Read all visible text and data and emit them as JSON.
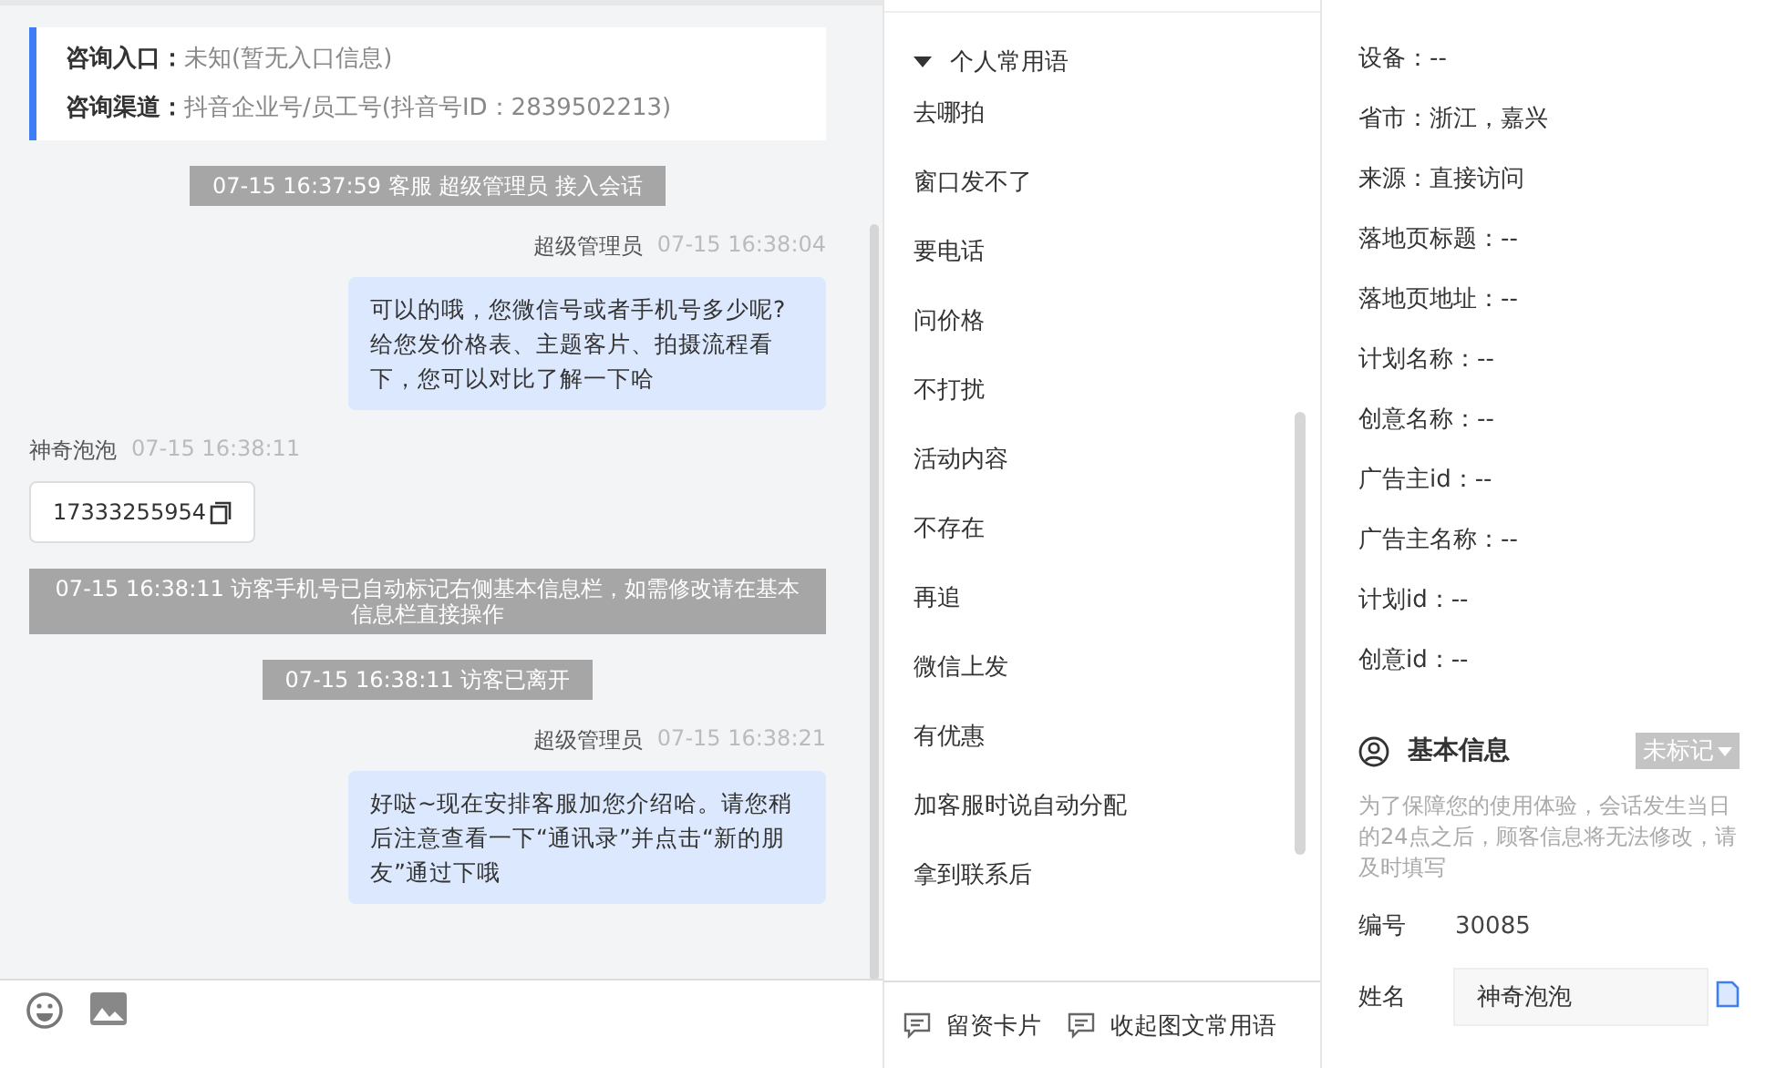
{
  "consult_info": [
    {
      "label": "咨询入口：",
      "value": "未知(暂无入口信息)"
    },
    {
      "label": "咨询渠道：",
      "value": "抖音企业号/员工号(抖音号ID：2839502213)"
    }
  ],
  "messages": [
    {
      "kind": "system",
      "text": "07-15 16:37:59 客服 超级管理员 接入会话"
    },
    {
      "kind": "agent",
      "sender": "超级管理员",
      "time": "07-15 16:38:04",
      "text": "可以的哦，您微信号或者手机号多少呢?给您发价格表、主题客片、拍摄流程看下，您可以对比了解一下哈"
    },
    {
      "kind": "visitor",
      "sender": "神奇泡泡",
      "time": "07-15 16:38:11",
      "text": "17333255954"
    },
    {
      "kind": "system",
      "text": "07-15 16:38:11 访客手机号已自动标记右侧基本信息栏，如需修改请在基本信息栏直接操作"
    },
    {
      "kind": "system",
      "text": "07-15 16:38:11 访客已离开"
    },
    {
      "kind": "agent",
      "sender": "超级管理员",
      "time": "07-15 16:38:21",
      "text": "好哒~现在安排客服加您介绍哈。请您稍后注意查看一下“通讯录”并点击“新的朋友”通过下哦"
    }
  ],
  "quick_phrases": {
    "group": "个人常用语",
    "expanded": true,
    "items": [
      "去哪拍",
      "窗口发不了",
      "要电话",
      "问价格",
      "不打扰",
      "活动内容",
      "不存在",
      "再追",
      "微信上发",
      "有优惠",
      "加客服时说自动分配",
      "拿到联系后"
    ]
  },
  "footer_actions": [
    "留资卡片",
    "收起图文常用语"
  ],
  "visitor_fields": [
    "设备：--",
    "省市：浙江，嘉兴",
    "来源：直接访问",
    "落地页标题：--",
    "落地页地址：--",
    "计划名称：--",
    "创意名称：--",
    "广告主id：--",
    "广告主名称：--",
    "计划id：--",
    "创意id：--"
  ],
  "basic_info": {
    "title": "基本信息",
    "tag": "未标记",
    "notice": "为了保障您的使用体验，会话发生当日的24点之后，顾客信息将无法修改，请及时填写",
    "fields": [
      {
        "kind": "text",
        "label": "编号",
        "value": "30085"
      },
      {
        "kind": "input",
        "label": "姓名",
        "value": "神奇泡泡"
      }
    ]
  }
}
